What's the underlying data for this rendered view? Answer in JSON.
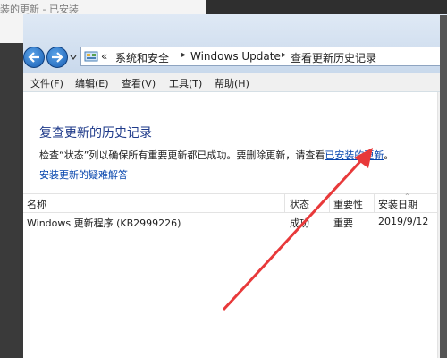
{
  "background": {
    "left_text": "装的更新 - 已安装"
  },
  "address": {
    "breadcrumbs": [
      "«",
      "系统和安全",
      "Windows Update",
      "查看更新历史记录"
    ]
  },
  "menu": [
    "文件(F)",
    "编辑(E)",
    "查看(V)",
    "工具(T)",
    "帮助(H)"
  ],
  "page": {
    "title": "复查更新的历史记录",
    "description_prefix": "检查“状态”列以确保所有重要更新都已成功。要删除更新，请查看",
    "installed_updates_link": "已安装的更新",
    "description_suffix": "。",
    "troubleshoot_link": "安装更新的疑难解答"
  },
  "table": {
    "columns": [
      "名称",
      "状态",
      "重要性",
      "安装日期"
    ],
    "rows": [
      [
        "Windows 更新程序 (KB2999226)",
        "成功",
        "重要",
        "2019/9/12"
      ]
    ]
  },
  "colors": {
    "annotation_arrow": "#e8393a",
    "link": "#0645ad",
    "title": "#1e3a8a"
  },
  "icons": [
    "back-arrow-icon",
    "forward-arrow-icon",
    "control-panel-icon",
    "dropdown-chevron-icon"
  ]
}
